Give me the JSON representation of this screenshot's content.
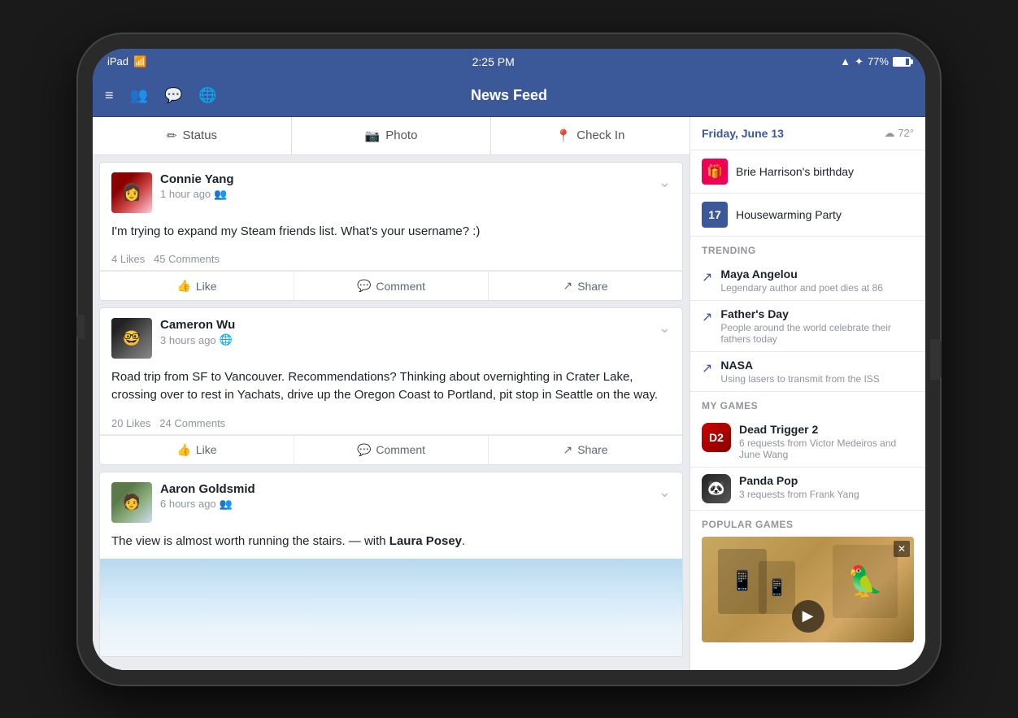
{
  "device": {
    "status_bar": {
      "carrier": "iPad",
      "wifi_icon": "📶",
      "time": "2:25 PM",
      "location_icon": "▲",
      "bluetooth_icon": "✦",
      "battery_pct": "77%"
    }
  },
  "header": {
    "menu_icon": "≡",
    "friends_icon": "👥",
    "messages_icon": "💬",
    "globe_icon": "🌐",
    "title": "News Feed"
  },
  "action_bar": {
    "status_icon": "✏",
    "status_label": "Status",
    "photo_icon": "📷",
    "photo_label": "Photo",
    "checkin_icon": "📍",
    "checkin_label": "Check In"
  },
  "posts": [
    {
      "id": "post1",
      "author": "Connie Yang",
      "time": "1 hour ago",
      "audience_icon": "👥",
      "body": "I'm trying to expand my Steam friends list. What's your username? :)",
      "likes": "4 Likes",
      "comments": "45 Comments",
      "like_label": "Like",
      "comment_label": "Comment",
      "share_label": "Share",
      "avatar_emoji": "👩"
    },
    {
      "id": "post2",
      "author": "Cameron Wu",
      "time": "3 hours ago",
      "audience_icon": "🌐",
      "body": "Road trip from SF to Vancouver. Recommendations? Thinking about overnighting in Crater Lake, crossing over to rest in Yachats, drive up the Oregon Coast to Portland, pit stop in Seattle on the way.",
      "likes": "20 Likes",
      "comments": "24 Comments",
      "like_label": "Like",
      "comment_label": "Comment",
      "share_label": "Share",
      "avatar_emoji": "🤓"
    },
    {
      "id": "post3",
      "author": "Aaron Goldsmid",
      "time": "6 hours ago",
      "audience_icon": "👥",
      "body_plain": "The view is almost worth running the stairs. — with ",
      "body_tagged": "Laura Posey",
      "body_end": ".",
      "avatar_emoji": "🧑"
    }
  ],
  "sidebar": {
    "date": "Friday, June 13",
    "weather_icon": "☁",
    "temperature": "72°",
    "events": [
      {
        "type": "birthday",
        "icon_text": "🎁",
        "name": "Brie Harrison's birthday"
      },
      {
        "type": "party",
        "icon_text": "17",
        "name": "Housewarming Party"
      }
    ],
    "trending_title": "TRENDING",
    "trending": [
      {
        "name": "Maya Angelou",
        "description": "Legendary author and poet dies at 86"
      },
      {
        "name": "Father's Day",
        "description": "People around the world celebrate their fathers today"
      },
      {
        "name": "NASA",
        "description": "Using lasers to transmit from the ISS"
      }
    ],
    "my_games_title": "MY GAMES",
    "my_games": [
      {
        "name": "Dead Trigger 2",
        "description": "6 requests from Victor Medeiros and June Wang",
        "icon": "🎮"
      },
      {
        "name": "Panda Pop",
        "description": "3 requests from Frank Yang",
        "icon": "🐼"
      }
    ],
    "popular_games_title": "POPULAR GAMES"
  }
}
